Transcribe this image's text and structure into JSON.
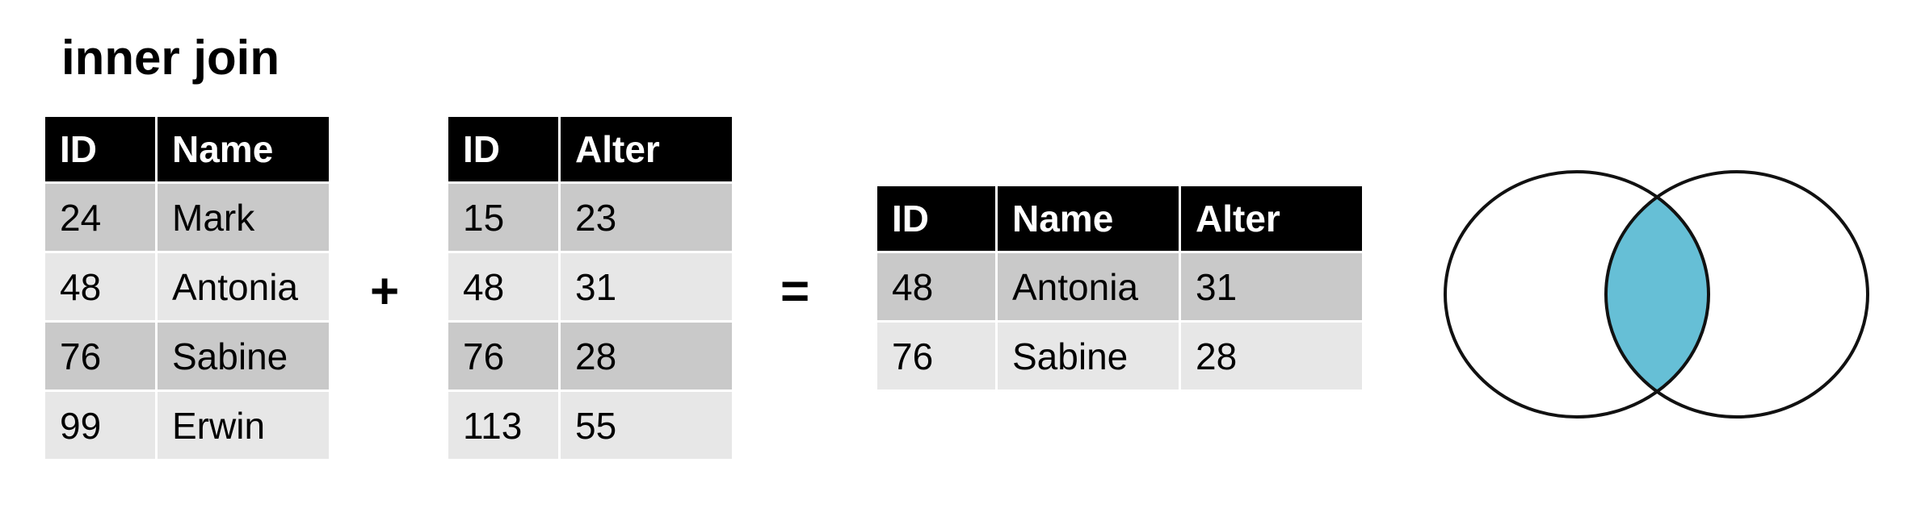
{
  "title": "inner join",
  "operators": {
    "plus": "+",
    "equals": "="
  },
  "left_table": {
    "headers": [
      "ID",
      "Name"
    ],
    "rows": [
      [
        "24",
        "Mark"
      ],
      [
        "48",
        "Antonia"
      ],
      [
        "76",
        "Sabine"
      ],
      [
        "99",
        "Erwin"
      ]
    ]
  },
  "right_table": {
    "headers": [
      "ID",
      "Alter"
    ],
    "rows": [
      [
        "15",
        "23"
      ],
      [
        "48",
        "31"
      ],
      [
        "76",
        "28"
      ],
      [
        "113",
        "55"
      ]
    ]
  },
  "result_table": {
    "headers": [
      "ID",
      "Name",
      "Alter"
    ],
    "rows": [
      [
        "48",
        "Antonia",
        "31"
      ],
      [
        "76",
        "Sabine",
        "28"
      ]
    ]
  },
  "venn": {
    "highlight_color": "#66bfd6",
    "outline_color": "#111111",
    "highlighted_region": "intersection"
  }
}
